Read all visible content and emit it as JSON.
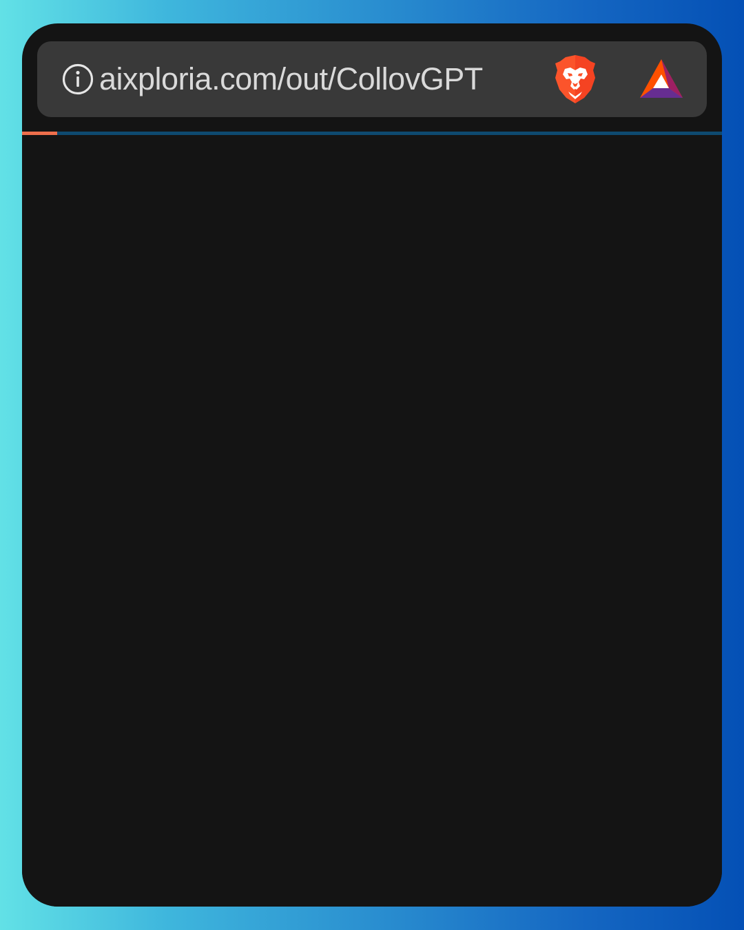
{
  "browser": {
    "url": "aixploria.com/out/CollovGPT",
    "icons": {
      "site_info": "info-circle-icon",
      "shields": "brave-lion-icon",
      "rewards": "bat-triangle-icon"
    },
    "load_progress": 0.05
  },
  "colors": {
    "background_gradient_start": "#62e1e6",
    "background_gradient_end": "#0450b5",
    "frame": "#141414",
    "url_bar": "#393939",
    "url_text": "#d9d9d9",
    "progress_fill": "#ee6f4c",
    "progress_track": "#0e4a70",
    "brave_orange": "#fb542b",
    "bat_orange": "#ff5000",
    "bat_purple": "#662d91",
    "bat_red": "#9e1f63"
  }
}
